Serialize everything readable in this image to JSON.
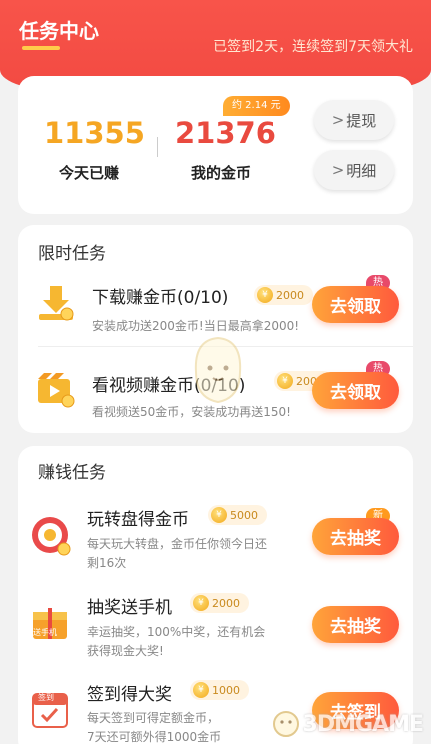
{
  "header": {
    "title": "任务中心",
    "status": "已签到2天，连续签到7天领大礼"
  },
  "wallet": {
    "today_value": "11355",
    "today_label": "今天已赚",
    "coins_value": "21376",
    "coins_label": "我的金币",
    "approx": "约 2.14 元",
    "withdraw_label": "提现",
    "detail_label": "明细"
  },
  "limited": {
    "title": "限时任务",
    "items": [
      {
        "title": "下载赚金币(0/10)",
        "reward": "2000",
        "desc": "安装成功送200金币!当日最高拿2000!",
        "tag": "热",
        "action": "去领取"
      },
      {
        "title": "看视频赚金币(0/10)",
        "reward": "2000",
        "desc": "看视频送50金币，安装成功再送150!",
        "tag": "热",
        "action": "去领取"
      }
    ]
  },
  "earn": {
    "title": "赚钱任务",
    "items": [
      {
        "title": "玩转盘得金币",
        "reward": "5000",
        "desc1": "每天玩大转盘，金币任你领今日还",
        "desc2": "剩16次",
        "tag": "新",
        "action": "去抽奖"
      },
      {
        "title": "抽奖送手机",
        "reward": "2000",
        "desc1": "幸运抽奖，100%中奖，还有机会",
        "desc2": "获得现金大奖!",
        "action": "去抽奖",
        "icon_text": "送手机"
      },
      {
        "title": "签到得大奖",
        "reward": "1000",
        "desc1": "每天签到可得定额金币，",
        "desc2": "7天还可额外得1000金币",
        "action": "去签到",
        "icon_text": "签到"
      }
    ]
  },
  "watermark": {
    "text": "3DMGAME"
  },
  "colors": {
    "header_red": "#f24a42",
    "accent_orange": "#f5a623",
    "coin_red": "#e94a3f",
    "button_start": "#ffa43a",
    "button_end": "#ff5a3c"
  }
}
